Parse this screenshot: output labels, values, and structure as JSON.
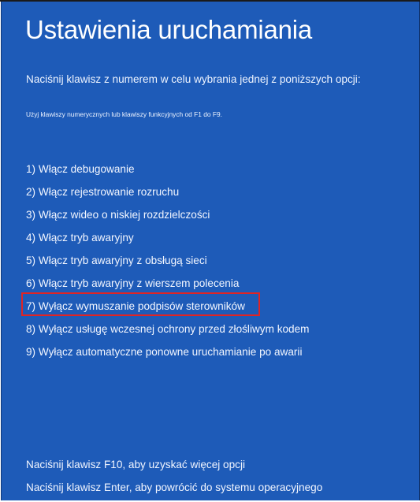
{
  "screen": {
    "title": "Ustawienia uruchamiania",
    "instruction": "Naciśnij klawisz z numerem w celu wybrania jednej z poniższych opcji:",
    "hint": "Użyj klawiszy numerycznych lub klawiszy funkcyjnych od F1 do F9.",
    "background_color": "#1e5bb8",
    "highlight_color": "#e02424"
  },
  "options": [
    {
      "label": "1) Włącz debugowanie"
    },
    {
      "label": "2) Włącz rejestrowanie rozruchu"
    },
    {
      "label": "3) Włącz wideo o niskiej rozdzielczości"
    },
    {
      "label": "4) Włącz tryb awaryjny"
    },
    {
      "label": "5) Włącz tryb awaryjny z obsługą sieci"
    },
    {
      "label": "6) Włącz tryb awaryjny z wierszem polecenia"
    },
    {
      "label": "7) Wyłącz wymuszanie podpisów sterowników",
      "highlighted": true
    },
    {
      "label": "8) Wyłącz usługę wczesnej ochrony przed złośliwym kodem"
    },
    {
      "label": "9) Wyłącz automatyczne ponowne uruchamianie po awarii"
    }
  ],
  "footer": {
    "more_options": "Naciśnij klawisz F10, aby uzyskać więcej opcji",
    "return": "Naciśnij klawisz Enter, aby powrócić do systemu operacyjnego"
  }
}
